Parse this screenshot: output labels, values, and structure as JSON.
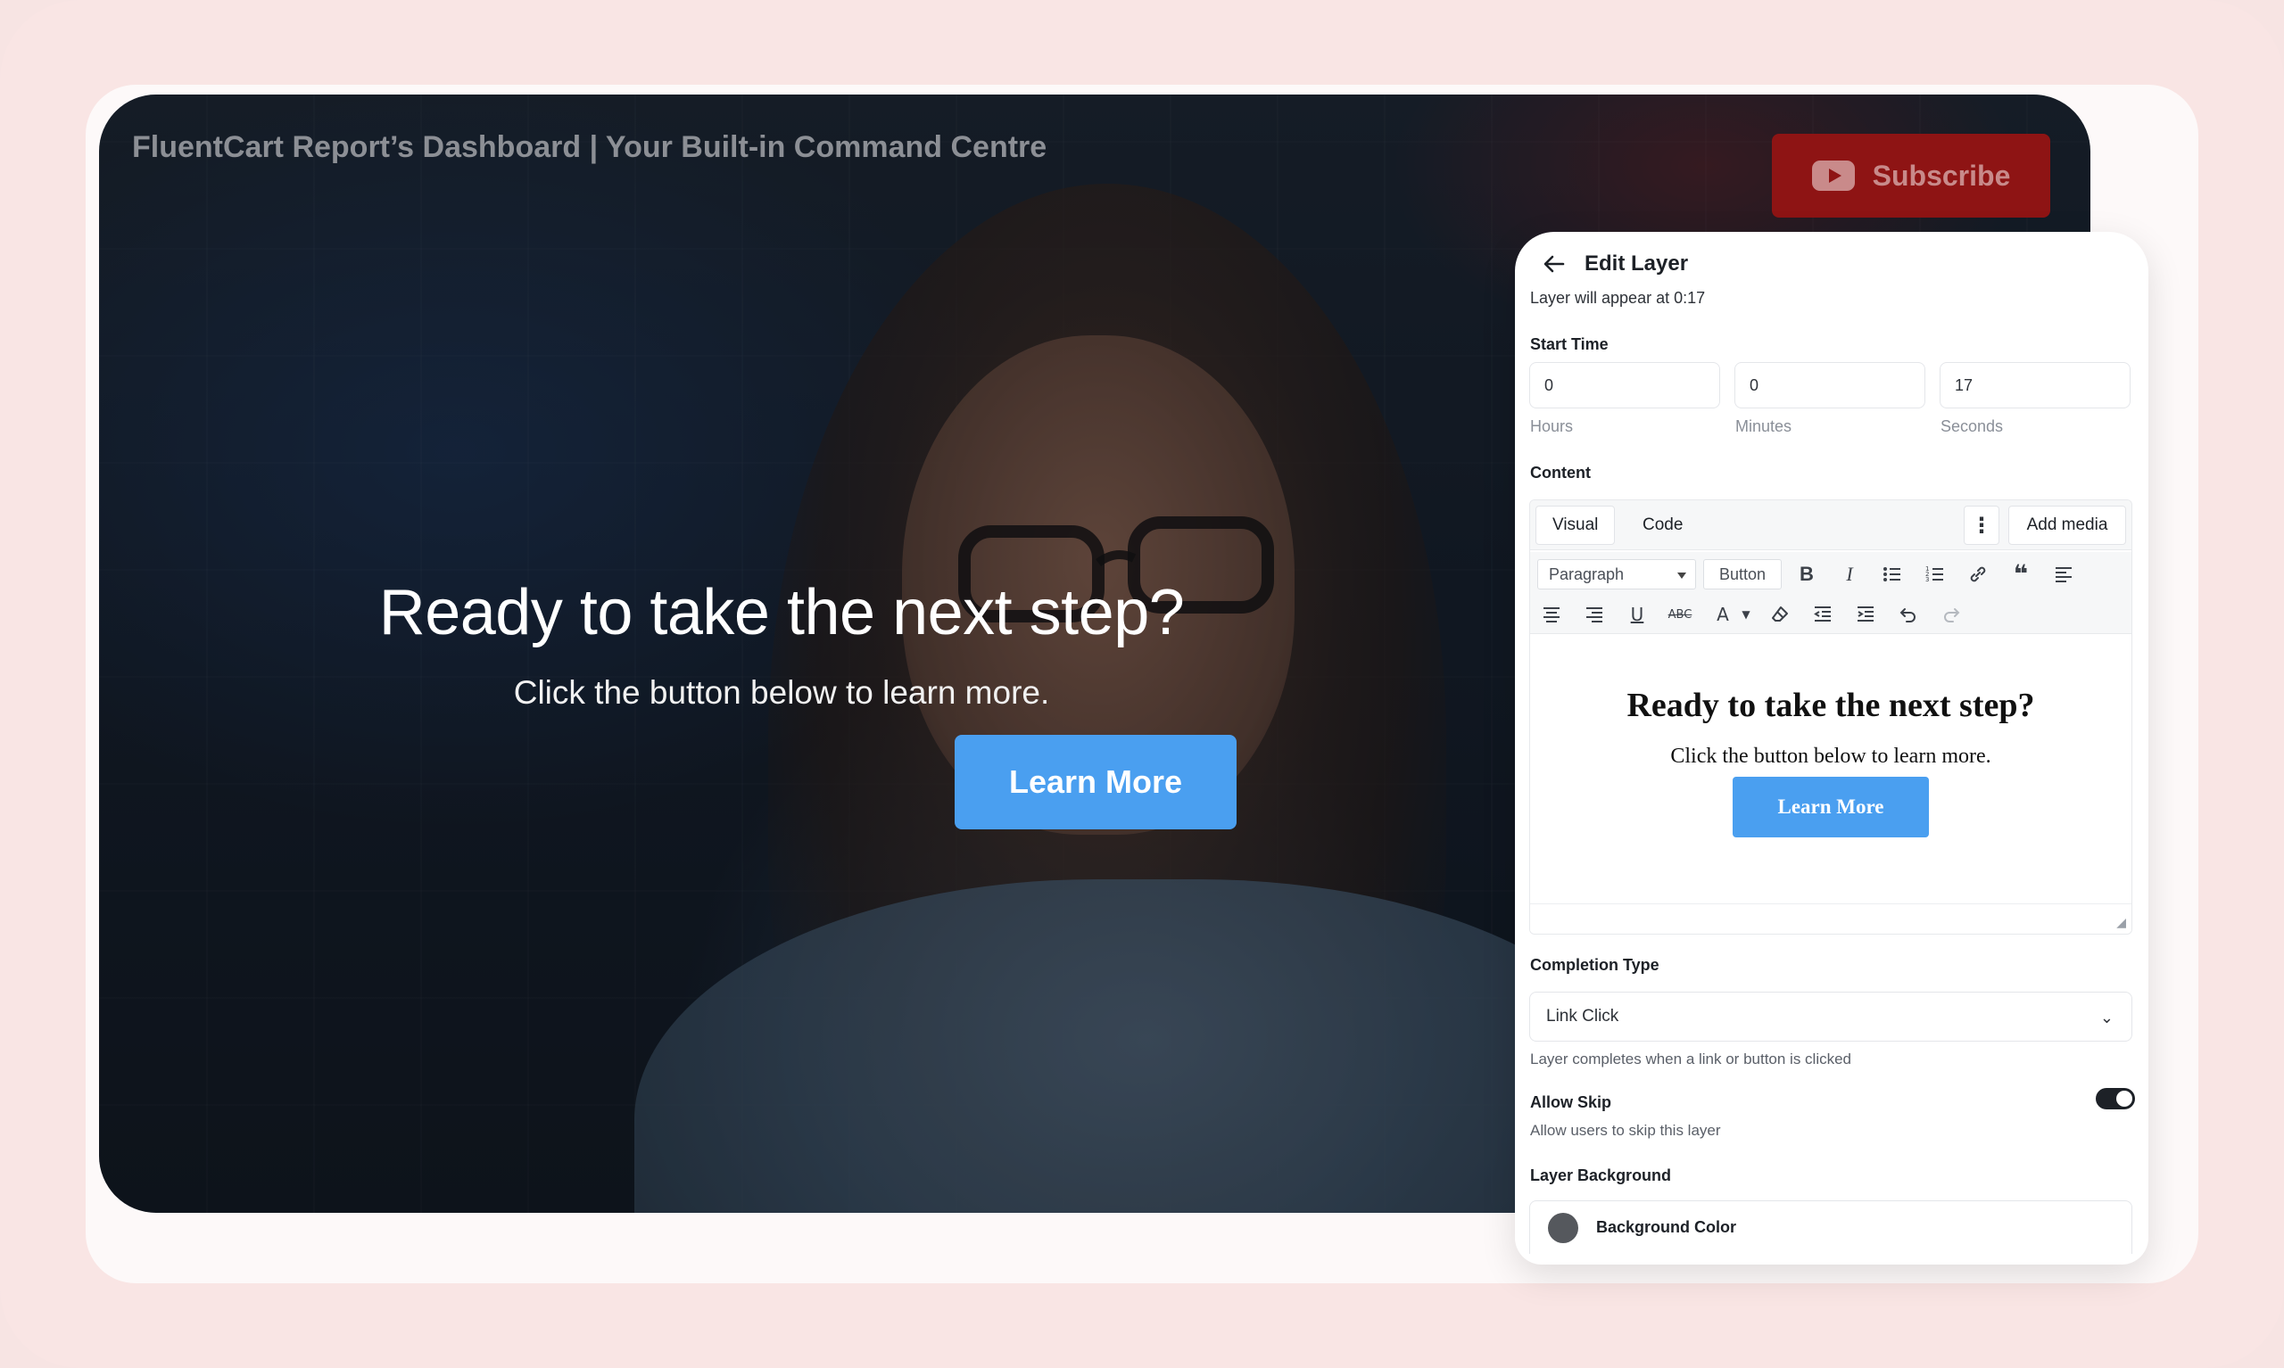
{
  "video": {
    "title": "FluentCart Report’s Dashboard | Your Built-in Command Centre",
    "subscribe_label": "Subscribe",
    "overlay": {
      "heading": "Ready to take the next step?",
      "subheading": "Click the button below to learn more.",
      "button_label": "Learn More"
    }
  },
  "panel": {
    "title": "Edit Layer",
    "subtitle": "Layer will appear at 0:17",
    "start_time_label": "Start Time",
    "hours_value": "0",
    "minutes_value": "0",
    "seconds_value": "17",
    "hours_caption": "Hours",
    "minutes_caption": "Minutes",
    "seconds_caption": "Seconds",
    "content_label": "Content",
    "editor": {
      "tab_visual": "Visual",
      "tab_code": "Code",
      "add_media": "Add media",
      "format_select": "Paragraph",
      "button_tool": "Button",
      "body_heading": "Ready to take the next step?",
      "body_sub": "Click the button below to learn more.",
      "body_button": "Learn More"
    },
    "completion_type_label": "Completion Type",
    "completion_type_value": "Link Click",
    "completion_hint": "Layer completes when a link or button is clicked",
    "allow_skip_label": "Allow Skip",
    "allow_skip_hint": "Allow users to skip this layer",
    "allow_skip_on": true,
    "layer_background_label": "Layer Background",
    "background_color_label": "Background Color",
    "background_color": "#55585d"
  },
  "colors": {
    "accent_blue": "#4a9ff0",
    "frame_pink": "#f9e5e4",
    "subscribe_red": "#8e1414"
  }
}
